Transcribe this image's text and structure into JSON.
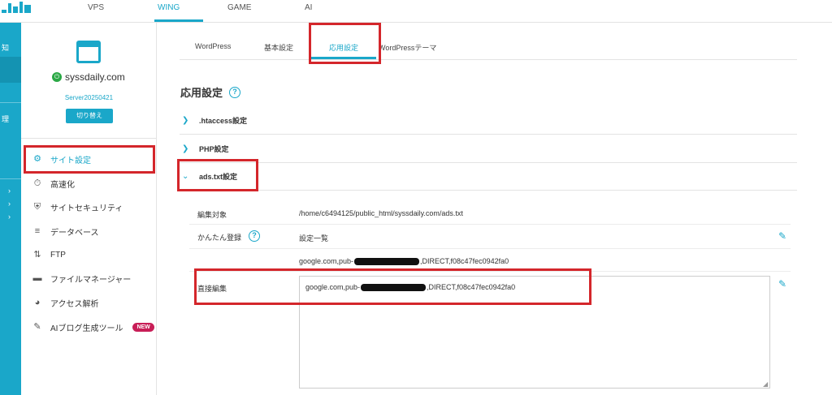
{
  "topnav": {
    "tabs": [
      {
        "label": "VPS"
      },
      {
        "label": "WING"
      },
      {
        "label": "GAME"
      },
      {
        "label": "AI"
      }
    ],
    "active_color": "#1aa7c9"
  },
  "leftbar": {
    "item_1": "知",
    "item_2": "理",
    "arrow": "›"
  },
  "sidebar": {
    "domain": "syssdaily.com",
    "server": "Server20250421",
    "switch_label": "切り替え",
    "items": [
      {
        "label": "サイト設定",
        "icon": "site-settings-icon"
      },
      {
        "label": "高速化",
        "icon": "stopwatch-icon"
      },
      {
        "label": "サイトセキュリティ",
        "icon": "shield-icon"
      },
      {
        "label": "データベース",
        "icon": "database-icon"
      },
      {
        "label": "FTP",
        "icon": "transfer-arrows-icon"
      },
      {
        "label": "ファイルマネージャー",
        "icon": "folder-icon"
      },
      {
        "label": "アクセス解析",
        "icon": "pie-chart-icon"
      },
      {
        "label": "AIブログ生成ツール",
        "icon": "ai-document-icon"
      }
    ],
    "new_badge": "NEW"
  },
  "main": {
    "subtabs": [
      {
        "label": "WordPress"
      },
      {
        "label": "基本設定"
      },
      {
        "label": "応用設定"
      },
      {
        "label": "WordPressテーマ"
      }
    ],
    "section_title": "応用設定",
    "help_glyph": "?",
    "accordions": [
      {
        "label": ".htaccess設定",
        "expanded": false
      },
      {
        "label": "PHP設定",
        "expanded": false
      },
      {
        "label": "ads.txt設定",
        "expanded": true
      }
    ],
    "ads": {
      "target_label": "編集対象",
      "target_path": "/home/c6494125/public_html/syssdaily.com/ads.txt",
      "easy_label": "かんたん登録",
      "list_label": "設定一覧",
      "entry_prefix": "google.com,pub-",
      "entry_suffix": ",DIRECT,f08c47fec0942fa0",
      "direct_label": "直接編集",
      "direct_prefix": "google.com,pub-",
      "direct_suffix": ",DIRECT,f08c47fec0942fa0"
    }
  },
  "annotation_color": "#d4262b"
}
